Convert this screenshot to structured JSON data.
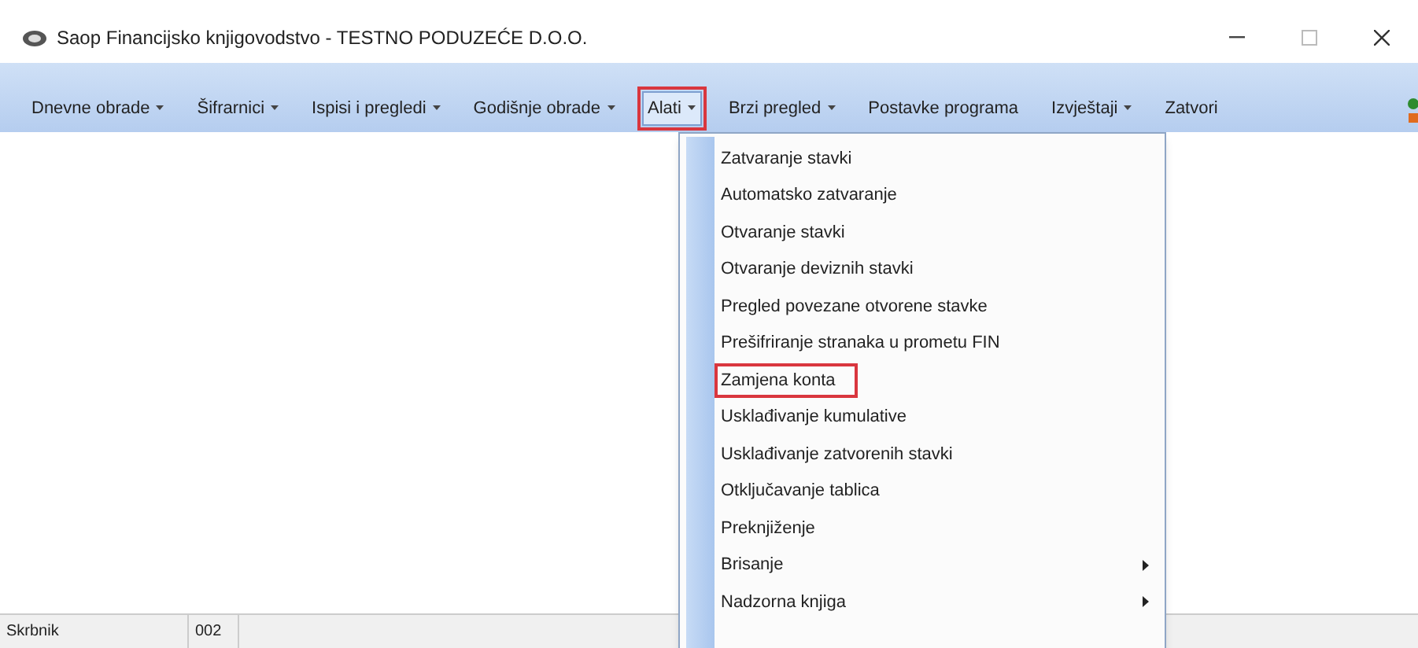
{
  "window": {
    "title": "Saop Financijsko knjigovodstvo - TESTNO PODUZEĆE D.O.O."
  },
  "menu_bar": [
    {
      "label": "Dnevne obrade",
      "dropdown": true,
      "selected": false
    },
    {
      "label": "Šifrarnici",
      "dropdown": true,
      "selected": false
    },
    {
      "label": "Ispisi i pregledi",
      "dropdown": true,
      "selected": false
    },
    {
      "label": "Godišnje obrade",
      "dropdown": true,
      "selected": false
    },
    {
      "label": "Alati",
      "dropdown": true,
      "selected": true
    },
    {
      "label": "Brzi pregled",
      "dropdown": true,
      "selected": false
    },
    {
      "label": "Postavke programa",
      "dropdown": false,
      "selected": false
    },
    {
      "label": "Izvještaji",
      "dropdown": true,
      "selected": false
    },
    {
      "label": "Zatvori",
      "dropdown": false,
      "selected": false
    }
  ],
  "dropdown_menu": [
    {
      "label": "Zatvaranje stavki",
      "submenu": false,
      "highlighted": false
    },
    {
      "label": "Automatsko zatvaranje",
      "submenu": false,
      "highlighted": false
    },
    {
      "label": "Otvaranje stavki",
      "submenu": false,
      "highlighted": false
    },
    {
      "label": "Otvaranje deviznih stavki",
      "submenu": false,
      "highlighted": false
    },
    {
      "label": "Pregled povezane otvorene stavke",
      "submenu": false,
      "highlighted": false
    },
    {
      "label": "Prešifriranje stranaka u prometu FIN",
      "submenu": false,
      "highlighted": false
    },
    {
      "label": "Zamjena konta",
      "submenu": false,
      "highlighted": true
    },
    {
      "label": "Usklađivanje kumulative",
      "submenu": false,
      "highlighted": false
    },
    {
      "label": "Usklađivanje zatvorenih stavki",
      "submenu": false,
      "highlighted": false
    },
    {
      "label": "Otključavanje tablica",
      "submenu": false,
      "highlighted": false
    },
    {
      "label": "Preknjiženje",
      "submenu": false,
      "highlighted": false
    },
    {
      "label": "Brisanje",
      "submenu": true,
      "highlighted": false
    },
    {
      "label": "Nadzorna knjiga",
      "submenu": true,
      "highlighted": false
    }
  ],
  "status_bar": [
    {
      "text": "Skrbnik"
    },
    {
      "text": "002"
    }
  ]
}
